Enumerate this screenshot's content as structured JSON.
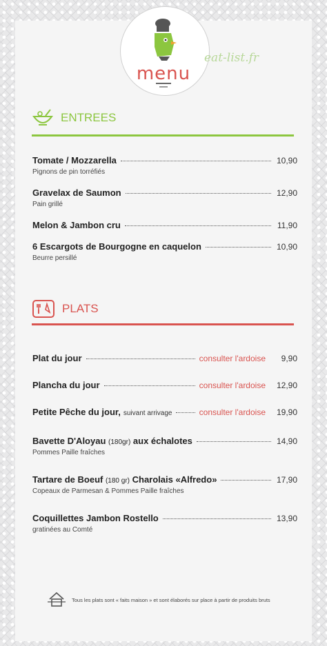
{
  "logo": {
    "word": "menu",
    "watermark": "eat-list.fr"
  },
  "sections": {
    "entrees": {
      "title": "ENTREES",
      "color": "#8cc63f"
    },
    "plats": {
      "title": "PLATS",
      "color": "#d9534f"
    }
  },
  "entrees": [
    {
      "name": "Tomate / Mozzarella",
      "desc": "Pignons de pin torréfiés",
      "price": "10,90"
    },
    {
      "name": "Gravelax de Saumon",
      "desc": "Pain grillé",
      "price": "12,90"
    },
    {
      "name": "Melon & Jambon cru",
      "price": "11,90"
    },
    {
      "name": "6 Escargots de Bourgogne en caquelon",
      "desc": "Beurre persillé",
      "price": "10,90"
    }
  ],
  "plats": [
    {
      "name": "Plat du jour",
      "ardoise": "consulter l'ardoise",
      "price": "9,90"
    },
    {
      "name": "Plancha du jour",
      "ardoise": "consulter l'ardoise",
      "price": "12,90"
    },
    {
      "name": "Petite Pêche du jour,",
      "note": "suivant arrivage",
      "ardoise": "consulter l'ardoise",
      "price": "19,90"
    },
    {
      "name_a": "Bavette D'Aloyau",
      "name_b": "(180gr)",
      "name_c": "aux échalotes",
      "desc": "Pommes Paille fraîches",
      "price": "14,90"
    },
    {
      "name_a": "Tartare de Boeuf",
      "name_b": "(180 gr)",
      "name_c": "Charolais «Alfredo»",
      "desc": "Copeaux de Parmesan & Pommes Paille fraîches",
      "price": "17,90"
    },
    {
      "name": "Coquillettes Jambon Rostello",
      "desc": "gratinées au Comté",
      "price": "13,90"
    }
  ],
  "footer": "Tous les plats sont « faits maison » et sont élaborés sur place à partir de produits bruts"
}
